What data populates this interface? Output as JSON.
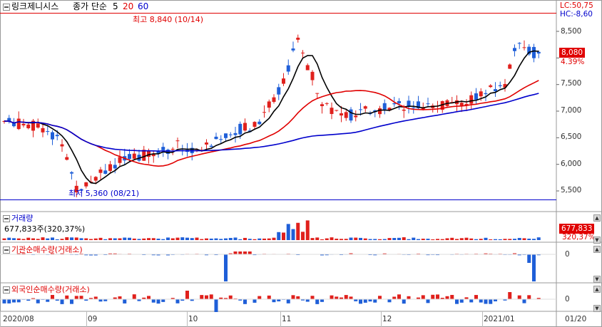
{
  "header": {
    "title": "링크제니시스",
    "ma_label": "종가 단순",
    "ma_periods": [
      "5",
      "20",
      "60"
    ],
    "ma_colors": [
      "#000000",
      "#e00000",
      "#0000cc"
    ]
  },
  "annotations": {
    "high": "최고 8,840 (10/14)",
    "low": "최저 5,360 (08/21)"
  },
  "right_info": {
    "lc": "LC:50,75",
    "hc": "HC:-8,60",
    "price_tag": "8,080",
    "change_pct": "4.39%"
  },
  "y_axis": [
    "8,500",
    "8,000",
    "7,500",
    "7,000",
    "6,500",
    "6,000",
    "5,500"
  ],
  "x_axis": [
    "2020/08",
    "09",
    "10",
    "11",
    "12",
    "2021/01",
    "01/20"
  ],
  "volume_panel": {
    "title": "거래량",
    "value_text": "677,833주(320,37%)",
    "tag": "677,833",
    "tag_pct": "320,37%"
  },
  "inst_panel": {
    "title": "기관순매수량(거래소)",
    "zero": "0"
  },
  "foreign_panel": {
    "title": "외국인순매수량(거래소)",
    "zero": "0"
  },
  "colors": {
    "up": "#e0201c",
    "down": "#1f5fd8",
    "ma5": "#000000",
    "ma20": "#e00000",
    "ma60": "#0000cc",
    "tag_bg": "#e00000"
  },
  "chart_data": {
    "type": "candlestick",
    "y_range": [
      5250,
      8900
    ],
    "high": 8840,
    "low": 5360,
    "last_close": 8080,
    "series": [
      {
        "name": "5",
        "color": "#000000"
      },
      {
        "name": "20",
        "color": "#e00000"
      },
      {
        "name": "60",
        "color": "#0000cc"
      }
    ]
  }
}
